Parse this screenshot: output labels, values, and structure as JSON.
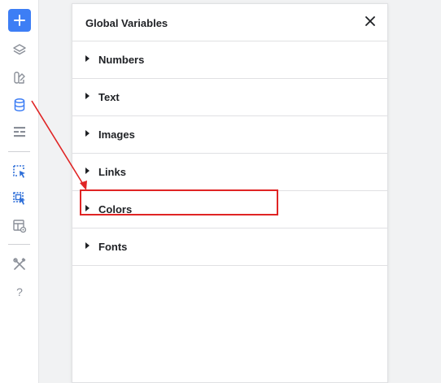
{
  "panel": {
    "title": "Global Variables",
    "sections": [
      {
        "label": "Numbers"
      },
      {
        "label": "Text"
      },
      {
        "label": "Images"
      },
      {
        "label": "Links"
      },
      {
        "label": "Colors"
      },
      {
        "label": "Fonts"
      }
    ]
  },
  "sidebar": {
    "icons": [
      "plus-icon",
      "layers-icon",
      "style-kit-icon",
      "database-icon",
      "list-icon",
      "select-element-icon",
      "multi-select-icon",
      "template-preview-icon",
      "tools-icon",
      "help-icon"
    ]
  },
  "colors": {
    "accent": "#3d7ef5",
    "highlight": "#e02424"
  }
}
